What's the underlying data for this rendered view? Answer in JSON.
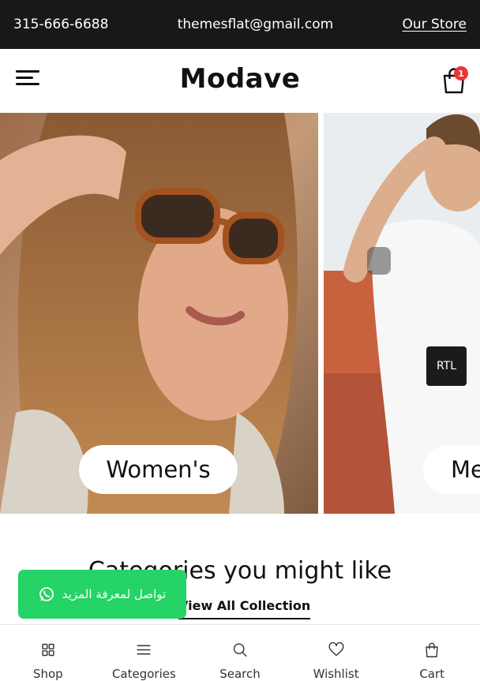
{
  "topbar": {
    "phone": "315-666-6688",
    "email": "themesflat@gmail.com",
    "store_link": "Our Store"
  },
  "header": {
    "logo": "Modave",
    "cart_count": "1",
    "icons": [
      "menu-icon",
      "shopping-bag-icon"
    ]
  },
  "banners": [
    {
      "label": "Women's"
    },
    {
      "label": "Men's"
    }
  ],
  "rtl_button": "RTL",
  "categories": {
    "title": "Categories you might like",
    "view_all": "View All Collection"
  },
  "whatsapp": {
    "text": "تواصل لمعرفة المزيد",
    "icon": "whatsapp-icon",
    "color": "#25d366"
  },
  "bottom_nav": [
    {
      "label": "Shop",
      "icon": "grid-icon"
    },
    {
      "label": "Categories",
      "icon": "list-icon"
    },
    {
      "label": "Search",
      "icon": "search-icon"
    },
    {
      "label": "Wishlist",
      "icon": "heart-icon"
    },
    {
      "label": "Cart",
      "icon": "bag-icon"
    }
  ],
  "colors": {
    "topbar": "#181818",
    "badge": "#e33333",
    "accent": "#25d366"
  }
}
